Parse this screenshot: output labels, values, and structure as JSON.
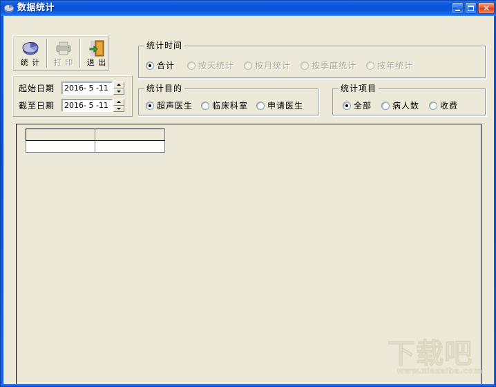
{
  "window": {
    "title": "数据统计",
    "icon": "pie-chart-icon",
    "buttons": {
      "minimize": "minimize-icon",
      "maximize": "maximize-icon",
      "close": "close-icon"
    }
  },
  "toolbar": {
    "buttons": [
      {
        "label": "统 计",
        "icon": "pie-chart-icon",
        "enabled": true
      },
      {
        "label": "打 印",
        "icon": "printer-icon",
        "enabled": false
      },
      {
        "label": "退 出",
        "icon": "exit-door-icon",
        "enabled": true
      }
    ]
  },
  "dates": {
    "start": {
      "label": "起始日期",
      "value": "2016- 5 -11"
    },
    "end": {
      "label": "截至日期",
      "value": "2016- 5 -11"
    }
  },
  "groups": {
    "time": {
      "legend": "统计时间",
      "options": [
        {
          "label": "合计",
          "checked": true,
          "enabled": true
        },
        {
          "label": "按天统计",
          "checked": false,
          "enabled": false
        },
        {
          "label": "按月统计",
          "checked": false,
          "enabled": false
        },
        {
          "label": "按季度统计",
          "checked": false,
          "enabled": false
        },
        {
          "label": "按年统计",
          "checked": false,
          "enabled": false
        }
      ]
    },
    "purpose": {
      "legend": "统计目的",
      "options": [
        {
          "label": "超声医生",
          "checked": true,
          "enabled": true
        },
        {
          "label": "临床科室",
          "checked": false,
          "enabled": true
        },
        {
          "label": "申请医生",
          "checked": false,
          "enabled": true
        }
      ]
    },
    "item": {
      "legend": "统计项目",
      "options": [
        {
          "label": "全部",
          "checked": true,
          "enabled": true
        },
        {
          "label": "病人数",
          "checked": false,
          "enabled": true
        },
        {
          "label": "收费",
          "checked": false,
          "enabled": true
        }
      ]
    }
  },
  "grid": {
    "headers": [
      "",
      ""
    ],
    "rows": [
      [
        "",
        ""
      ]
    ]
  },
  "watermark": {
    "text": "下载吧",
    "url": "www.xiazaiba.com"
  },
  "colors": {
    "titlebar": "#0a55dd",
    "face": "#ece9d8",
    "close": "#d3421d"
  }
}
